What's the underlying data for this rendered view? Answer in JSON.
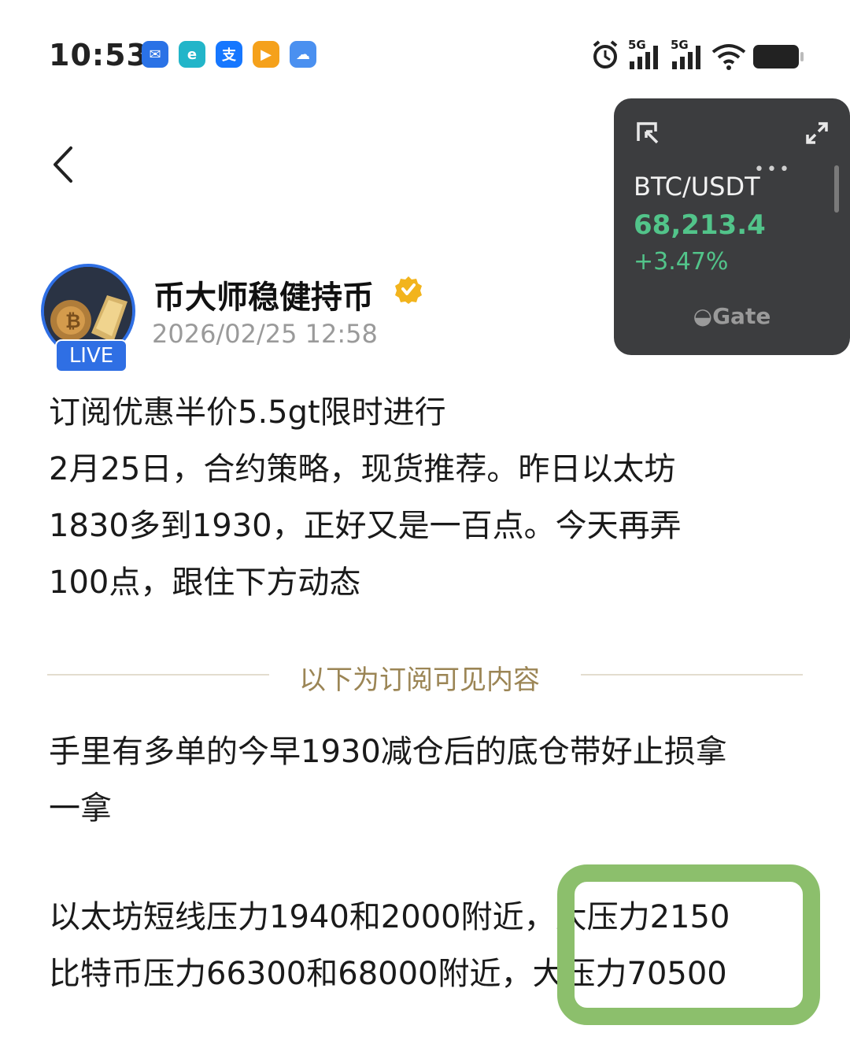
{
  "status_bar": {
    "time": "10:53",
    "signal_1": "5G",
    "signal_2": "5G"
  },
  "widget": {
    "pair": "BTC/USDT",
    "price": "68,213.4",
    "change": "+3.47%",
    "brand": "Gate",
    "price_color": "#52c48a"
  },
  "post": {
    "author": "币大师稳健持币",
    "timestamp": "2026/02/25 12:58",
    "live_badge": "LIVE",
    "line1": "订阅优惠半价5.5gt限时进行",
    "line2": "2月25日，合约策略，现货推荐。昨日以太坊",
    "line3": "1830多到1930，正好又是一百点。今天再弄",
    "line4": "100点，跟住下方动态",
    "divider": "以下为订阅可见内容",
    "sub_line1": "手里有多单的今早1930减仓后的底仓带好止损拿",
    "sub_line2": "一拿",
    "sub_line3": "以太坊短线压力1940和2000附近，大压力2150",
    "sub_line4": "比特币压力66300和68000附近，大压力70500"
  },
  "colors": {
    "accent_blue": "#2f6fe4",
    "highlight_green": "#8cbf6c",
    "divider_gold": "#9b8555"
  }
}
